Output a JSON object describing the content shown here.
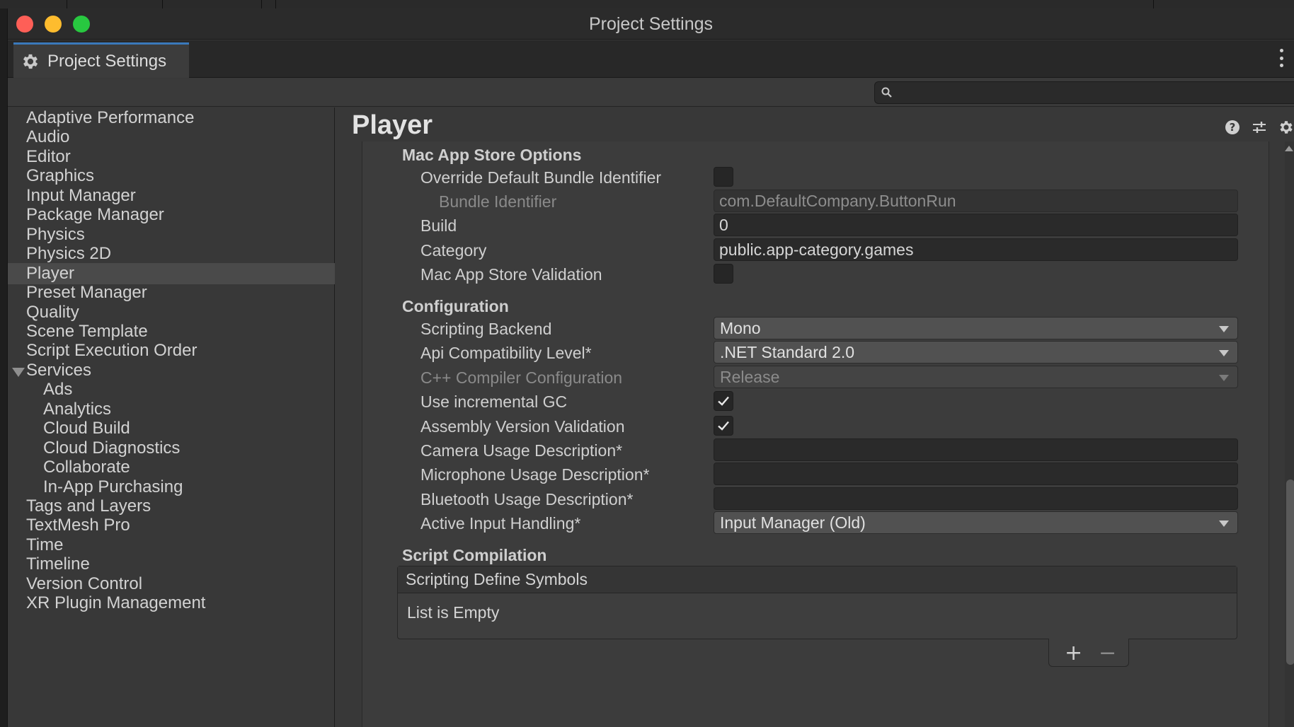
{
  "window": {
    "title": "Project Settings"
  },
  "tab": {
    "label": "Project Settings"
  },
  "search": {
    "placeholder": ""
  },
  "sidebar": {
    "items": [
      {
        "label": "Adaptive Performance"
      },
      {
        "label": "Audio"
      },
      {
        "label": "Editor"
      },
      {
        "label": "Graphics"
      },
      {
        "label": "Input Manager"
      },
      {
        "label": "Package Manager"
      },
      {
        "label": "Physics"
      },
      {
        "label": "Physics 2D"
      },
      {
        "label": "Player",
        "selected": true
      },
      {
        "label": "Preset Manager"
      },
      {
        "label": "Quality"
      },
      {
        "label": "Scene Template"
      },
      {
        "label": "Script Execution Order"
      },
      {
        "label": "Services",
        "expanded": true
      },
      {
        "label": "Ads",
        "child": true
      },
      {
        "label": "Analytics",
        "child": true
      },
      {
        "label": "Cloud Build",
        "child": true
      },
      {
        "label": "Cloud Diagnostics",
        "child": true
      },
      {
        "label": "Collaborate",
        "child": true
      },
      {
        "label": "In-App Purchasing",
        "child": true
      },
      {
        "label": "Tags and Layers"
      },
      {
        "label": "TextMesh Pro"
      },
      {
        "label": "Time"
      },
      {
        "label": "Timeline"
      },
      {
        "label": "Version Control"
      },
      {
        "label": "XR Plugin Management"
      }
    ]
  },
  "main": {
    "title": "Player",
    "mac_app_store": {
      "heading": "Mac App Store Options",
      "override_bundle_label": "Override Default Bundle Identifier",
      "override_bundle_checked": false,
      "bundle_id_label": "Bundle Identifier",
      "bundle_id_value": "com.DefaultCompany.ButtonRun",
      "build_label": "Build",
      "build_value": "0",
      "category_label": "Category",
      "category_value": "public.app-category.games",
      "validation_label": "Mac App Store Validation",
      "validation_checked": false
    },
    "configuration": {
      "heading": "Configuration",
      "scripting_backend_label": "Scripting Backend",
      "scripting_backend_value": "Mono",
      "api_level_label": "Api Compatibility Level*",
      "api_level_value": ".NET Standard 2.0",
      "cpp_config_label": "C++ Compiler Configuration",
      "cpp_config_value": "Release",
      "incremental_gc_label": "Use incremental GC",
      "incremental_gc_checked": true,
      "assembly_validation_label": "Assembly Version Validation",
      "assembly_validation_checked": true,
      "camera_usage_label": "Camera Usage Description*",
      "camera_usage_value": "",
      "microphone_usage_label": "Microphone Usage Description*",
      "microphone_usage_value": "",
      "bluetooth_usage_label": "Bluetooth Usage Description*",
      "bluetooth_usage_value": "",
      "input_handling_label": "Active Input Handling*",
      "input_handling_value": "Input Manager (Old)"
    },
    "script_compilation": {
      "heading": "Script Compilation",
      "list_header": "Scripting Define Symbols",
      "list_empty": "List is Empty",
      "add_symbol": "+",
      "remove_symbol": "−"
    }
  },
  "icons": {
    "tab": "gear-icon",
    "search": "search-icon",
    "help": "help-icon",
    "presets": "sliders-icon",
    "settings": "gear-icon",
    "menu": "kebab-icon"
  },
  "colors": {
    "close": "#fe5f57",
    "minimize": "#febc2e",
    "maximize": "#28c840",
    "tab_accent": "#3a79bb",
    "selection": "#4a4a4a"
  }
}
